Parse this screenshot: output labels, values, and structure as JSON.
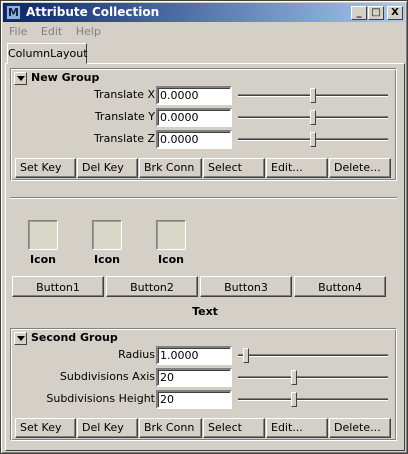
{
  "window": {
    "title": "Attribute Collection",
    "app_icon": "maya-icon",
    "buttons": {
      "minimize": "_",
      "maximize": "□",
      "close": "X"
    }
  },
  "menu": [
    "File",
    "Edit",
    "Help"
  ],
  "tab": {
    "label": "ColumnLayout"
  },
  "group1": {
    "title": "New Group",
    "rows": [
      {
        "label": "Translate X",
        "value": "0.0000",
        "slider": 0.5
      },
      {
        "label": "Translate Y",
        "value": "0.0000",
        "slider": 0.5
      },
      {
        "label": "Translate Z",
        "value": "0.0000",
        "slider": 0.5
      }
    ],
    "buttons": [
      "Set Key",
      "Del Key",
      "Brk Conn",
      "Select",
      "Edit...",
      "Delete..."
    ]
  },
  "icons": [
    {
      "label": "Icon"
    },
    {
      "label": "Icon"
    },
    {
      "label": "Icon"
    }
  ],
  "buttons": [
    "Button1",
    "Button2",
    "Button3",
    "Button4"
  ],
  "text_label": "Text",
  "group2": {
    "title": "Second Group",
    "rows": [
      {
        "label": "Radius",
        "value": "1.0000",
        "slider": 0.05
      },
      {
        "label": "Subdivisions Axis",
        "value": "20",
        "slider": 0.37
      },
      {
        "label": "Subdivisions Height",
        "value": "20",
        "slider": 0.37
      }
    ],
    "buttons": [
      "Set Key",
      "Del Key",
      "Brk Conn",
      "Select",
      "Edit...",
      "Delete..."
    ]
  }
}
